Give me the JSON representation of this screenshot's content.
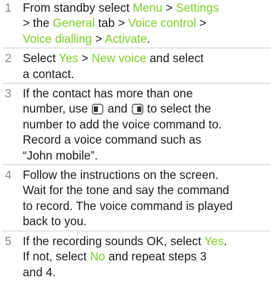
{
  "steps": [
    {
      "number": "1",
      "lines": [
        [
          {
            "t": "From standby select "
          },
          {
            "t": "Menu",
            "hl": true
          },
          {
            "t": " > "
          },
          {
            "t": "Settings",
            "hl": true
          }
        ],
        [
          {
            "t": "> the "
          },
          {
            "t": "General",
            "hl": true
          },
          {
            "t": " tab > "
          },
          {
            "t": "Voice control",
            "hl": true
          },
          {
            "t": " >"
          }
        ],
        [
          {
            "t": "Voice dialling",
            "hl": true
          },
          {
            "t": " > "
          },
          {
            "t": "Activate",
            "hl": true
          },
          {
            "t": "."
          }
        ]
      ]
    },
    {
      "number": "2",
      "lines": [
        [
          {
            "t": "Select "
          },
          {
            "t": "Yes",
            "hl": true
          },
          {
            "t": " > "
          },
          {
            "t": "New voice",
            "hl": true
          },
          {
            "t": " and select"
          }
        ],
        [
          {
            "t": "a contact."
          }
        ]
      ]
    },
    {
      "number": "3",
      "lines": [
        [
          {
            "t": "If the contact has more than one"
          }
        ],
        [
          {
            "t": "number, use "
          },
          {
            "icon": "left-nav-key-icon"
          },
          {
            "t": " and "
          },
          {
            "icon": "right-nav-key-icon"
          },
          {
            "t": " to select the"
          }
        ],
        [
          {
            "t": "number to add the voice command to."
          }
        ],
        [
          {
            "t": "Record a voice command such as"
          }
        ],
        [
          {
            "t": "“John mobile”."
          }
        ]
      ]
    },
    {
      "number": "4",
      "lines": [
        [
          {
            "t": "Follow the instructions on the screen."
          }
        ],
        [
          {
            "t": "Wait for the tone and say the command"
          }
        ],
        [
          {
            "t": "to record. The voice command is played"
          }
        ],
        [
          {
            "t": "back to you."
          }
        ]
      ]
    },
    {
      "number": "5",
      "lines": [
        [
          {
            "t": "If the recording sounds OK, select "
          },
          {
            "t": "Yes",
            "hl": true
          },
          {
            "t": "."
          }
        ],
        [
          {
            "t": "If not, select "
          },
          {
            "t": "No",
            "hl": true
          },
          {
            "t": " and repeat steps 3"
          }
        ],
        [
          {
            "t": "and 4."
          }
        ]
      ]
    }
  ],
  "colors": {
    "highlight": "#7ccf22",
    "step_number": "#8a8a8a",
    "text": "#1a1a1a",
    "divider": "#cfcfcf"
  }
}
